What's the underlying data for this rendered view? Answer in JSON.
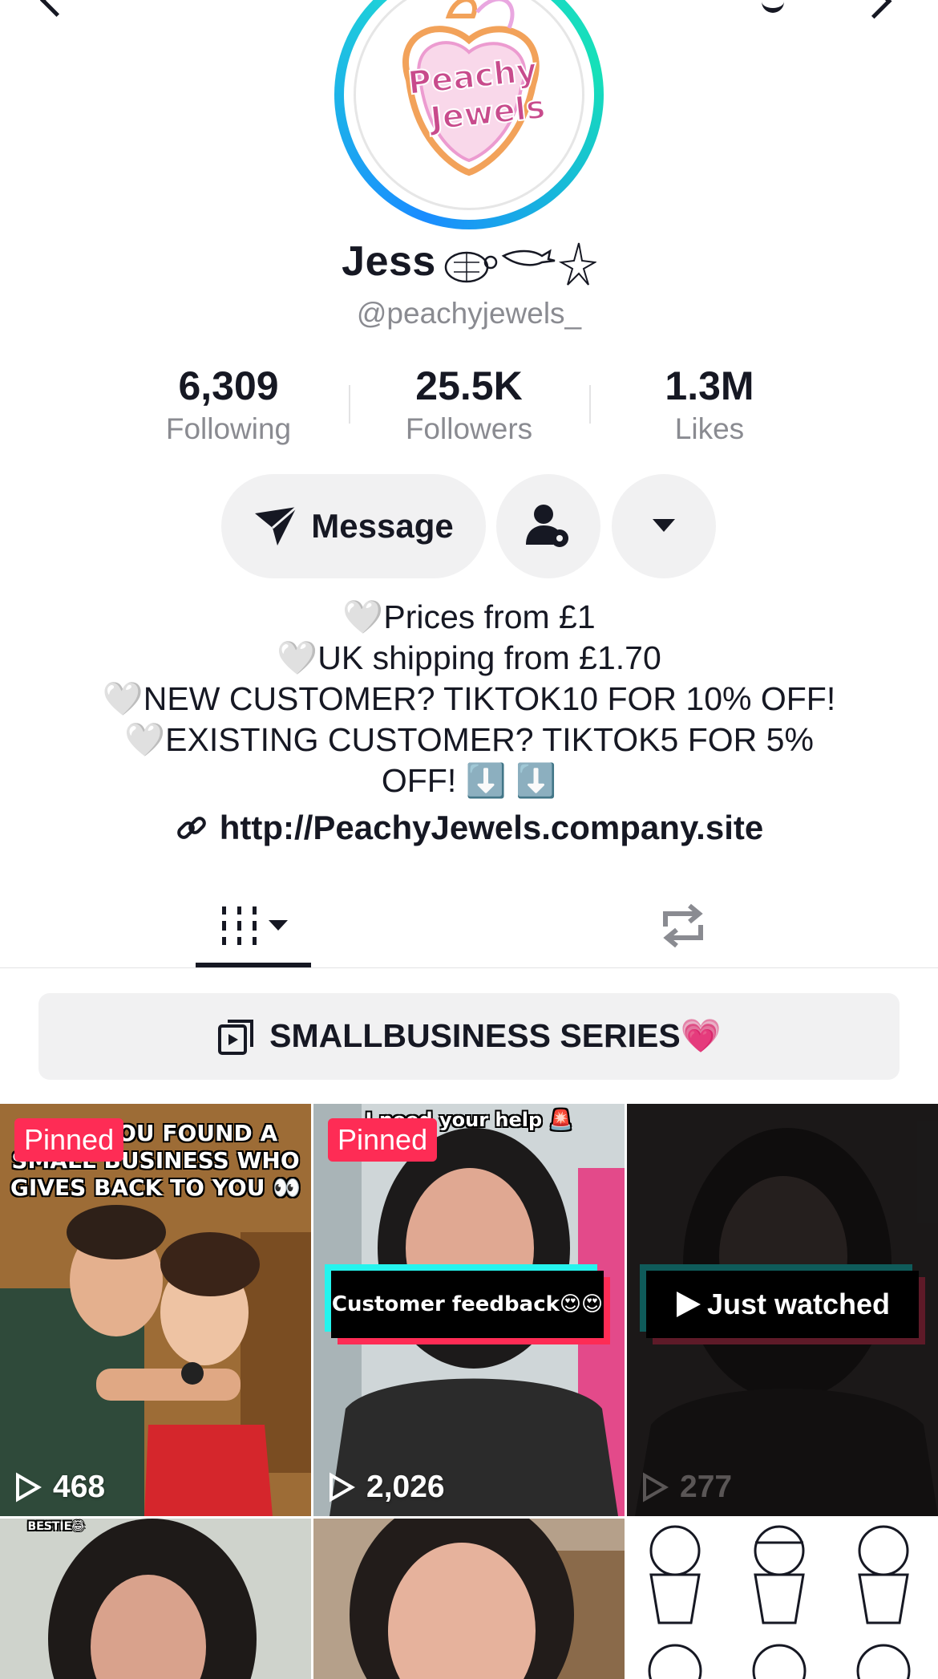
{
  "profile": {
    "logo_text_line1": "Peachy",
    "logo_text_line2": "Jewels",
    "name": "Jess",
    "name_emoji": "turtle-shark-starfish-icons",
    "handle": "@peachyjewels_"
  },
  "stats": [
    {
      "value": "6,309",
      "label": "Following"
    },
    {
      "value": "25.5K",
      "label": "Followers"
    },
    {
      "value": "1.3M",
      "label": "Likes"
    }
  ],
  "actions": {
    "message_label": "Message"
  },
  "bio": {
    "lines": [
      "🤍Prices from £1",
      "🤍UK shipping from £1.70",
      "🤍NEW CUSTOMER? TIKTOK10 FOR 10% OFF!",
      "🤍EXISTING CUSTOMER? TIKTOK5 FOR 5%",
      "OFF! ⬇️ ⬇️"
    ],
    "link": "http://PeachyJewels.company.site"
  },
  "series": {
    "label": "SMALLBUSINESS SERIES💗"
  },
  "videos": [
    {
      "caption": "POV: YOU FOUND A SMALL BUSINESS WHO GIVES BACK TO YOU 👀",
      "pinned": "Pinned",
      "views": "468"
    },
    {
      "caption": "I need your help 🚨",
      "pinned": "Pinned",
      "banner": "Customer feedback😍😍",
      "views": "2,026"
    },
    {
      "banner": "Just watched",
      "views": "277"
    },
    {
      "caption": "BESTIE😂"
    },
    {},
    {}
  ],
  "colors": {
    "accent": "#fe2c55",
    "teal": "#25f4ee",
    "muted": "#8a8b91",
    "button_bg": "#f1f1f2"
  }
}
